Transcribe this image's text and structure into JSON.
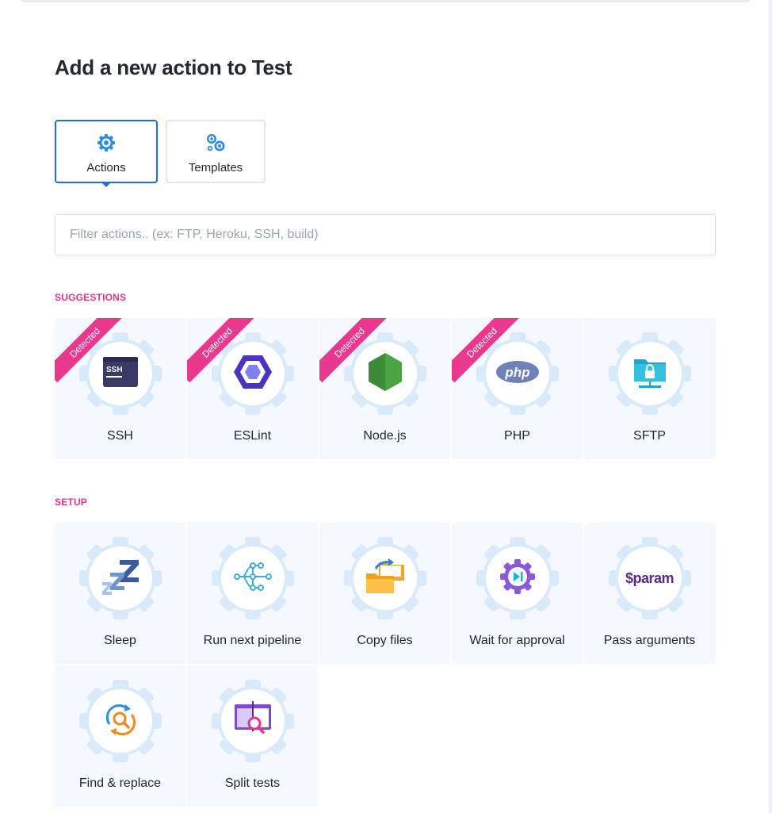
{
  "page": {
    "title": "Add a new action to Test"
  },
  "tabs": [
    {
      "label": "Actions",
      "icon": "gear-icon",
      "active": true
    },
    {
      "label": "Templates",
      "icon": "gears-icon",
      "active": false
    }
  ],
  "filter": {
    "placeholder": "Filter actions.. (ex: FTP, Heroku, SSH, build)",
    "value": ""
  },
  "sections": {
    "suggestions": {
      "label": "SUGGESTIONS",
      "items": [
        {
          "label": "SSH",
          "badge": "Detected",
          "icon": "ssh-terminal-icon"
        },
        {
          "label": "ESLint",
          "badge": "Detected",
          "icon": "eslint-hexagon-icon"
        },
        {
          "label": "Node.js",
          "badge": "Detected",
          "icon": "nodejs-hexagon-icon"
        },
        {
          "label": "PHP",
          "badge": "Detected",
          "icon": "php-logo-icon"
        },
        {
          "label": "SFTP",
          "icon": "sftp-folder-lock-icon"
        }
      ]
    },
    "setup": {
      "label": "SETUP",
      "items": [
        {
          "label": "Sleep",
          "icon": "sleep-zzz-icon"
        },
        {
          "label": "Run next pipeline",
          "icon": "pipeline-graph-icon"
        },
        {
          "label": "Copy files",
          "icon": "copy-folders-icon"
        },
        {
          "label": "Wait for approval",
          "icon": "approval-gear-icon"
        },
        {
          "label": "Pass arguments",
          "icon": "param-variable-icon",
          "icon_text": "$param"
        },
        {
          "label": "Find & replace",
          "icon": "find-replace-icon"
        },
        {
          "label": "Split tests",
          "icon": "split-tests-icon"
        }
      ]
    }
  },
  "colors": {
    "accent": "#1f6fe0",
    "section": "#e8338a",
    "ribbon": "#e9388d",
    "card_bg": "#f5f9fd",
    "gear": "#d9ebfb"
  }
}
